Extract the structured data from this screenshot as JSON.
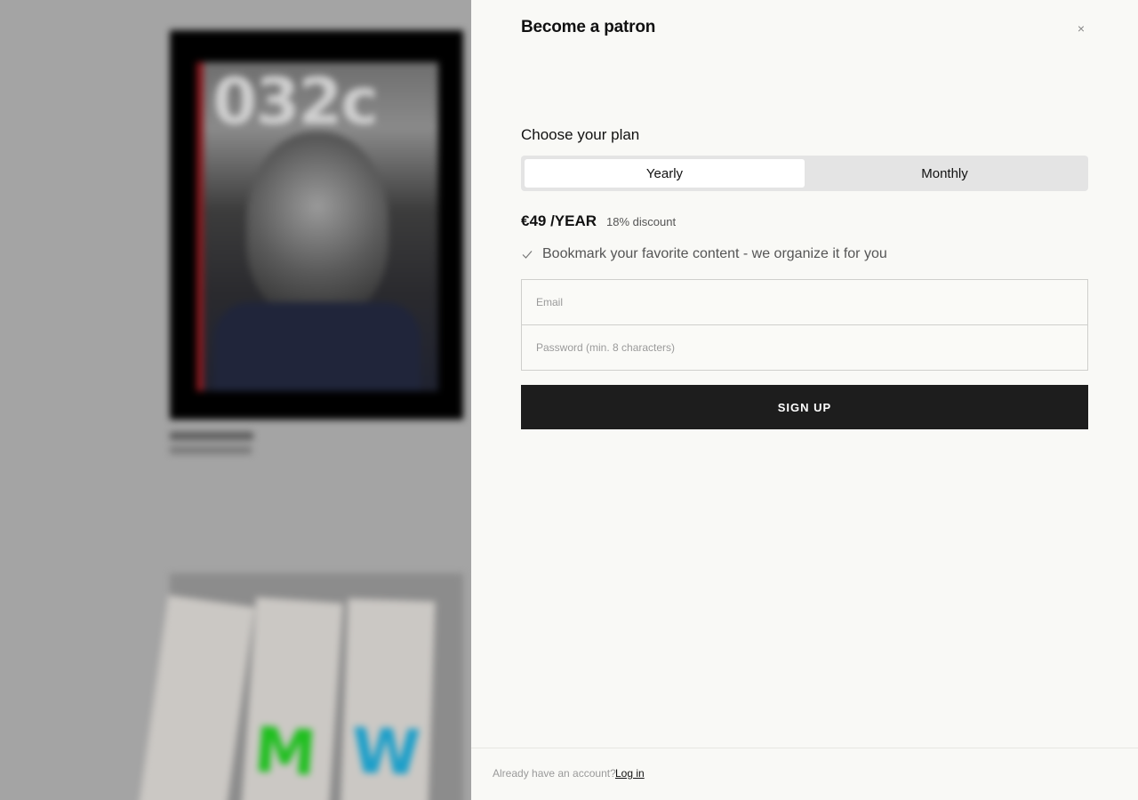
{
  "background": {
    "cover_masthead": "032c",
    "magazine_letters": [
      "",
      "M",
      "W"
    ],
    "colors": {
      "overlay": "#a4a4a4",
      "cover_red_strip": "#8b1a1f",
      "letter_green": "#1fbf1f",
      "letter_blue": "#1d9fc9",
      "letter_yellow": "#d9a41c"
    }
  },
  "modal": {
    "title": "Become a patron",
    "close_symbol": "×",
    "plan_heading": "Choose your plan",
    "plans": [
      {
        "label": "Yearly",
        "active": true
      },
      {
        "label": "Monthly",
        "active": false
      }
    ],
    "price": "€49 /YEAR",
    "discount": "18% discount",
    "features": [
      {
        "icon": "check-icon",
        "text": "Bookmark your favorite content - we organize it for you"
      }
    ],
    "email_placeholder": "Email",
    "password_placeholder": "Password (min. 8 characters)",
    "signup_label": "SIGN UP",
    "footer_text": "Already have an account?",
    "login_label": "Log in",
    "colors": {
      "panel_bg": "#f9f9f6",
      "toggle_bg": "#e4e4e4",
      "button_bg": "#1d1d1d"
    }
  }
}
